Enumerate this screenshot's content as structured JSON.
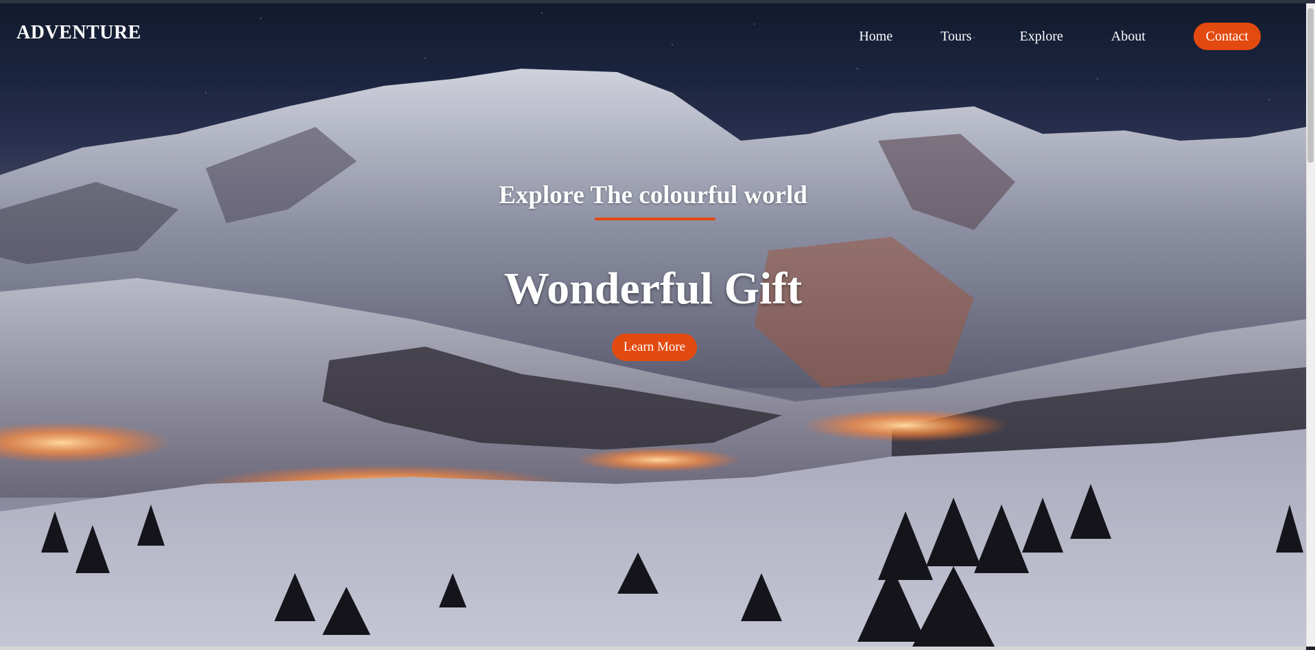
{
  "brand": {
    "name": "ADVENTURE"
  },
  "nav": {
    "items": [
      {
        "label": "Home"
      },
      {
        "label": "Tours"
      },
      {
        "label": "Explore"
      },
      {
        "label": "About"
      }
    ],
    "contact_label": "Contact"
  },
  "hero": {
    "subtitle": "Explore The colourful world",
    "title": "Wonderful Gift",
    "button_label": "Learn More",
    "background_description": "night-time snowy mountain ski resort with glowing orange lights"
  },
  "colors": {
    "accent": "#e34a10",
    "text": "#ffffff",
    "sky": "#1c2540"
  }
}
